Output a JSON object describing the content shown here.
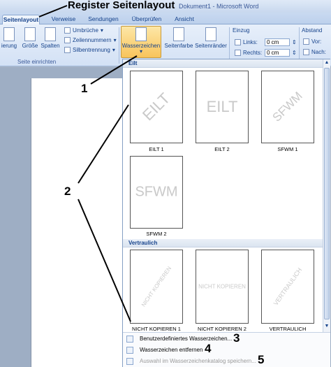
{
  "window": {
    "title": "Dokument1 - Microsoft Word"
  },
  "annotations": {
    "heading": "Register Seitenlayout",
    "n1": "1",
    "n2": "2",
    "n3": "3",
    "n4": "4",
    "n5": "5"
  },
  "tabs": [
    "Seitenlayout",
    "Verweise",
    "Sendungen",
    "Überprüfen",
    "Ansicht"
  ],
  "ribbon": {
    "orientation_partial": "ierung",
    "size": "Größe",
    "columns": "Spalten",
    "breaks": "Umbrüche",
    "line_numbers": "Zeilennummern",
    "hyphenation": "Silbentrennung",
    "watermark": "Wasserzeichen",
    "page_color": "Seitenfarbe",
    "page_borders": "Seitenränder",
    "group_page_setup": "Seite einrichten",
    "indent": {
      "title": "Einzug",
      "left_label": "Links:",
      "left_value": "0 cm",
      "right_label": "Rechts:",
      "right_value": "0 cm"
    },
    "spacing": {
      "title": "Abstand",
      "before_label": "Vor:",
      "after_label": "Nach:"
    }
  },
  "gallery": {
    "categories": [
      {
        "name": "Eilt",
        "items": [
          {
            "caption": "EILT 1",
            "watermark": "EILT",
            "style": "diagonal"
          },
          {
            "caption": "EILT 2",
            "watermark": "EILT",
            "style": "horizontal"
          },
          {
            "caption": "SFWM 1",
            "watermark": "SFWM",
            "style": "diagonal"
          },
          {
            "caption": "SFWM 2",
            "watermark": "SFWM",
            "style": "horizontal"
          }
        ]
      },
      {
        "name": "Vertraulich",
        "items": [
          {
            "caption": "NICHT KOPIEREN 1",
            "watermark": "NICHT KOPIEREN",
            "style": "diagonal"
          },
          {
            "caption": "NICHT KOPIEREN 2",
            "watermark": "NICHT KOPIEREN",
            "style": "horizontal"
          },
          {
            "caption": "VERTRAULICH",
            "watermark": "VERTRAULICH",
            "style": "diagonal"
          }
        ]
      }
    ],
    "menu": [
      {
        "label": "Benutzerdefiniertes Wasserzeichen...",
        "enabled": true
      },
      {
        "label": "Wasserzeichen entfernen",
        "enabled": true
      },
      {
        "label": "Auswahl im Wasserzeichenkatalog speichern...",
        "enabled": false
      }
    ]
  }
}
